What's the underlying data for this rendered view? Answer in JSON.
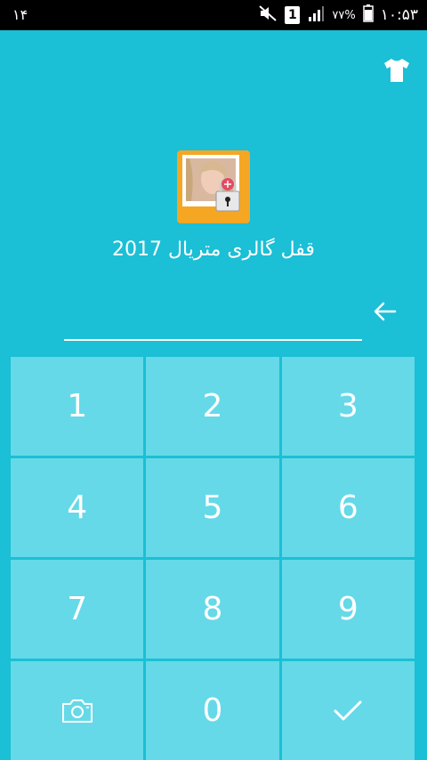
{
  "status_bar": {
    "notification_count": "۱۴",
    "sim_slot": "1",
    "battery_percent": "۷۷%",
    "time": "۱۰:۵۳",
    "icons": [
      "mute-icon",
      "sim-icon",
      "signal-icon",
      "battery-icon"
    ]
  },
  "header": {
    "theme_icon": "tshirt-icon"
  },
  "app": {
    "icon": "gallery-lock-icon",
    "title": "قفل گالری متریال 2017"
  },
  "pin": {
    "value": "",
    "backspace_icon": "backspace-arrow-icon"
  },
  "keypad": {
    "keys": [
      {
        "label": "1"
      },
      {
        "label": "2"
      },
      {
        "label": "3"
      },
      {
        "label": "4"
      },
      {
        "label": "5"
      },
      {
        "label": "6"
      },
      {
        "label": "7"
      },
      {
        "label": "8"
      },
      {
        "label": "9"
      },
      {
        "label": "",
        "icon": "camera-icon"
      },
      {
        "label": "0"
      },
      {
        "label": "",
        "icon": "checkmark-icon"
      }
    ]
  },
  "colors": {
    "background": "#1bbfd6",
    "key_background": "#65d9e8",
    "status_bar": "#000000",
    "text": "#ffffff",
    "icon_frame": "#f5a623"
  }
}
